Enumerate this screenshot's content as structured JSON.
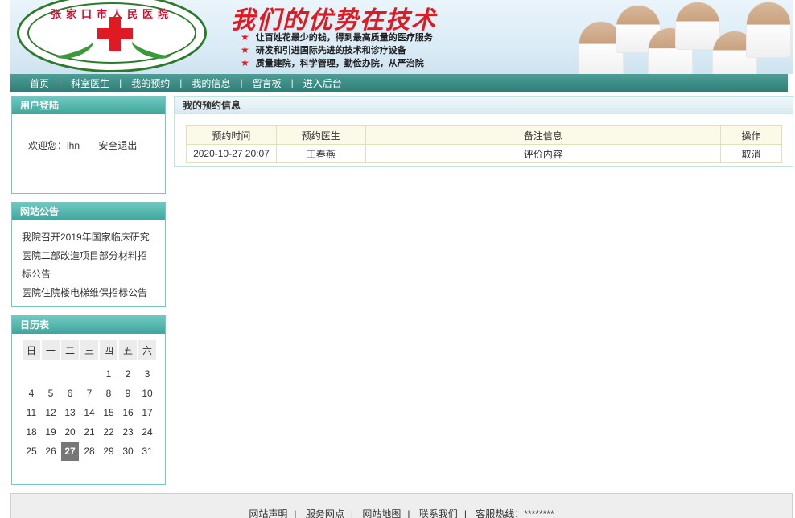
{
  "banner": {
    "logo_text": "张家口市人民医院",
    "slogan": "我们的优势在技术",
    "bullets": [
      "让百姓花最少的钱，得到最高质量的医疗服务",
      "研发和引进国际先进的技术和诊疗设备",
      "质量建院，科学管理，勤俭办院，从严治院"
    ]
  },
  "nav": {
    "items": [
      "首页",
      "科室医生",
      "我的预约",
      "我的信息",
      "留言板",
      "进入后台"
    ],
    "separator": "|"
  },
  "login": {
    "title": "用户登陆",
    "welcome": "欢迎您：lhn",
    "logout": "安全退出"
  },
  "notice": {
    "title": "网站公告",
    "items": [
      "我院召开2019年国家临床研究",
      "医院二部改造项目部分材料招标公告",
      "医院住院楼电梯维保招标公告"
    ]
  },
  "calendar": {
    "title": "日历表",
    "weekdays": [
      "日",
      "一",
      "二",
      "三",
      "四",
      "五",
      "六"
    ],
    "weeks": [
      [
        "",
        "",
        "",
        "",
        "1",
        "2",
        "3"
      ],
      [
        "4",
        "5",
        "6",
        "7",
        "8",
        "9",
        "10"
      ],
      [
        "11",
        "12",
        "13",
        "14",
        "15",
        "16",
        "17"
      ],
      [
        "18",
        "19",
        "20",
        "21",
        "22",
        "23",
        "24"
      ],
      [
        "25",
        "26",
        "27",
        "28",
        "29",
        "30",
        "31"
      ]
    ],
    "today": "27"
  },
  "main": {
    "title": "我的预约信息",
    "columns": [
      "预约时间",
      "预约医生",
      "备注信息",
      "操作"
    ],
    "rows": [
      {
        "time": "2020-10-27 20:07",
        "doctor": "王春燕",
        "note": "评价内容",
        "action": "取消"
      }
    ]
  },
  "footer": {
    "links": [
      "网站声明",
      "服务网点",
      "网站地图",
      "联系我们"
    ],
    "hotline": "客服热线：********",
    "separator": "|"
  },
  "colors": {
    "nav_bg": "#3a8c85",
    "box_title_bg": "#4fb3aa",
    "box_border": "#79c6c0",
    "slogan_red": "#e01a22",
    "today_bg": "#777777"
  }
}
